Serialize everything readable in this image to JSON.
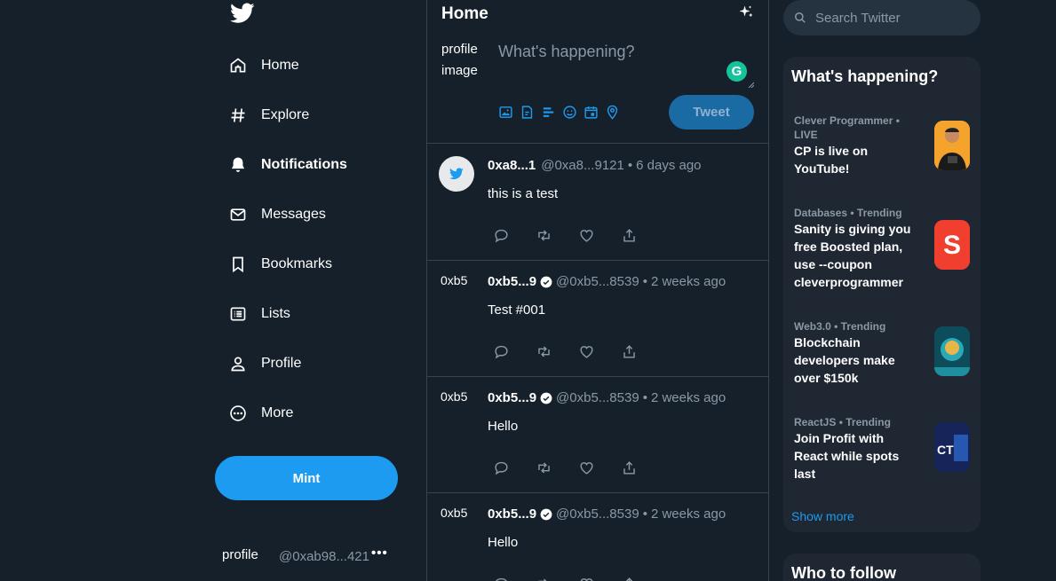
{
  "sidebar": {
    "items": [
      {
        "label": "Home",
        "icon": "home-icon"
      },
      {
        "label": "Explore",
        "icon": "hashtag-icon"
      },
      {
        "label": "Notifications",
        "icon": "bell-icon"
      },
      {
        "label": "Messages",
        "icon": "envelope-icon"
      },
      {
        "label": "Bookmarks",
        "icon": "bookmark-icon"
      },
      {
        "label": "Lists",
        "icon": "list-icon"
      },
      {
        "label": "Profile",
        "icon": "person-icon"
      },
      {
        "label": "More",
        "icon": "more-circle-icon"
      }
    ],
    "mint_label": "Mint",
    "account": {
      "img_alt": "profile",
      "handle": "@0xab98...421",
      "dots": "•••"
    }
  },
  "feed": {
    "title": "Home",
    "composer": {
      "img_alt": "profile image",
      "placeholder": "What's happening?",
      "tweet_label": "Tweet"
    },
    "tweets": [
      {
        "name": "0xa8...1",
        "handle": "@0xa8...9121",
        "time": "6 days ago",
        "text": "this is a test",
        "avatar": "bird"
      },
      {
        "name": "0xb5...9",
        "handle": "@0xb5...8539",
        "time": "2 weeks ago",
        "text": "Test #001",
        "avatar_alt": "0xb5"
      },
      {
        "name": "0xb5...9",
        "handle": "@0xb5...8539",
        "time": "2 weeks ago",
        "text": "Hello",
        "avatar_alt": "0xb5"
      },
      {
        "name": "0xb5...9",
        "handle": "@0xb5...8539",
        "time": "2 weeks ago",
        "text": "Hello",
        "avatar_alt": "0xb5"
      }
    ]
  },
  "right": {
    "search_placeholder": "Search Twitter",
    "trends_title": "What's happening?",
    "trends": [
      {
        "meta": "Clever Programmer • LIVE",
        "title": "CP is live on YouTube!"
      },
      {
        "meta": "Databases • Trending",
        "title": "Sanity is giving you free Boosted plan, use --coupon cleverprogrammer"
      },
      {
        "meta": "Web3.0 • Trending",
        "title": "Blockchain developers make over $150k"
      },
      {
        "meta": "ReactJS • Trending",
        "title": "Join Profit with React while spots last"
      }
    ],
    "show_more": "Show more",
    "who_to_follow": "Who to follow"
  },
  "colors": {
    "accent": "#1d9bf0",
    "background": "#15202b",
    "muted": "#8b98a5",
    "border": "#38444d"
  }
}
